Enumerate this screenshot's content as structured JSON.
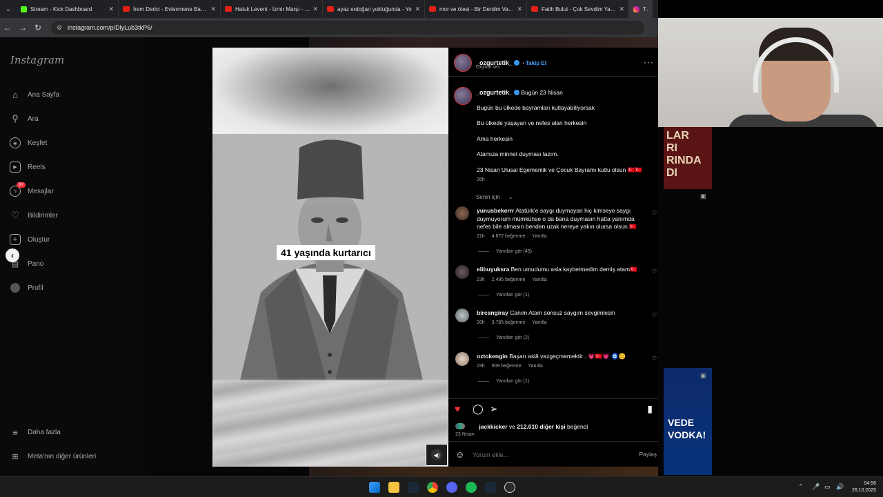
{
  "browser": {
    "tabs": [
      {
        "title": "Stream - Kick Dashboard",
        "icon": "kick"
      },
      {
        "title": "İrem Derici - Evlenmene Bak - Yo",
        "icon": "youtube"
      },
      {
        "title": "Haluk Levent - İzmir Marşı - Yo",
        "icon": "youtube"
      },
      {
        "title": "ayaz erdoğan yokluğunda - Yo",
        "icon": "youtube"
      },
      {
        "title": "mor ve ötesi - Bir Derdim Var (c",
        "icon": "youtube"
      },
      {
        "title": "Fatih Bulut - Çok Sevdim Yalan",
        "icon": "youtube"
      },
      {
        "title": "Tüm",
        "icon": "instagram"
      }
    ],
    "url": "instagram.com/p/DlyLub3tkP6/"
  },
  "sidebar": {
    "logo": "Instagram",
    "items": [
      {
        "label": "Ana Sayfa",
        "icon": "home-icon"
      },
      {
        "label": "Ara",
        "icon": "search-icon"
      },
      {
        "label": "Keşfet",
        "icon": "compass-icon"
      },
      {
        "label": "Reels",
        "icon": "reels-icon"
      },
      {
        "label": "Mesajlar",
        "icon": "messenger-icon",
        "badge": "9+"
      },
      {
        "label": "Bildirimler",
        "icon": "heart-icon"
      },
      {
        "label": "Oluştur",
        "icon": "plus-icon"
      },
      {
        "label": "Pano",
        "icon": "dashboard-icon"
      },
      {
        "label": "Profil",
        "icon": "profile-icon"
      }
    ],
    "more": "Daha fazla",
    "meta": "Meta'nın diğer ürünleri"
  },
  "post": {
    "media_caption": "41 yaşında kurtarıcı",
    "author": "_ozgurtetik_",
    "follow_label": "Takip Et",
    "audio": "Orijinal ses",
    "caption_title": "Bugün 23 Nisan",
    "caption_lines": [
      "Bugün bu ülkede bayramları kutlayabiliyorsak",
      "Bu ülkede yaşayan ve nefes alan herkesin",
      "Ama herkesin",
      "Atamıza minnet duyması lazım.",
      "23 Nisan Ulusal Egemenlik ve Çocuk Bayramı kutlu olsun 🇹🇷🇹🇷"
    ],
    "caption_time": "26h",
    "for_you": "Senin için",
    "comments": [
      {
        "user": "yunusbekerrr",
        "text": "Atatürk'e saygı duymayan hiç kimseye saygı duymuyorum mümkünse o da bana duymasın hatta yanımda nefes bile almasın benden uzak nereye yakın olursa olsun.🇹🇷",
        "time": "21h",
        "likes": "4.672 beğenme",
        "reply": "Yanıtla",
        "replies": "Yanıtları gör (45)"
      },
      {
        "user": "elibuyuksra",
        "text": "Ben umudumu asla kaybetmedim demiş atam🇹🇷",
        "time": "23h",
        "likes": "2.495 beğenme",
        "reply": "Yanıtla",
        "replies": "Yanıtları gör (1)"
      },
      {
        "user": "bircangiray",
        "text": "Canım Atam sonsuz saygım sevgimlesin",
        "time": "26h",
        "likes": "3.785 beğenme",
        "reply": "Yanıtla",
        "replies": "Yanıtları gör (2)"
      },
      {
        "user": "oztokengin",
        "text": "Başarı aslâ vazgeçmemektir . 💗🇹🇷💗 🧿😊",
        "time": "23h",
        "likes": "909 beğenme",
        "reply": "Yanıtla",
        "replies": "Yanıtları gör (1)"
      }
    ],
    "liked_by_user": "jackkicker",
    "liked_by_others": "212.010 diğer kişi",
    "liked_prefix": "ve",
    "liked_suffix": "beğendi",
    "date": "23 Nisan",
    "comment_placeholder": "Yorum ekle...",
    "share_label": "Paylaş"
  },
  "stream": {
    "thumb1_text": "LAR\nRI\nRINDA\nDI",
    "thumb2_text": "VEDE\nVODKA!"
  },
  "taskbar": {
    "time": "04:56",
    "date": "26.10.2025"
  },
  "colors": {
    "accent_blue": "#4aa3ff",
    "like_red": "#ff3040"
  }
}
